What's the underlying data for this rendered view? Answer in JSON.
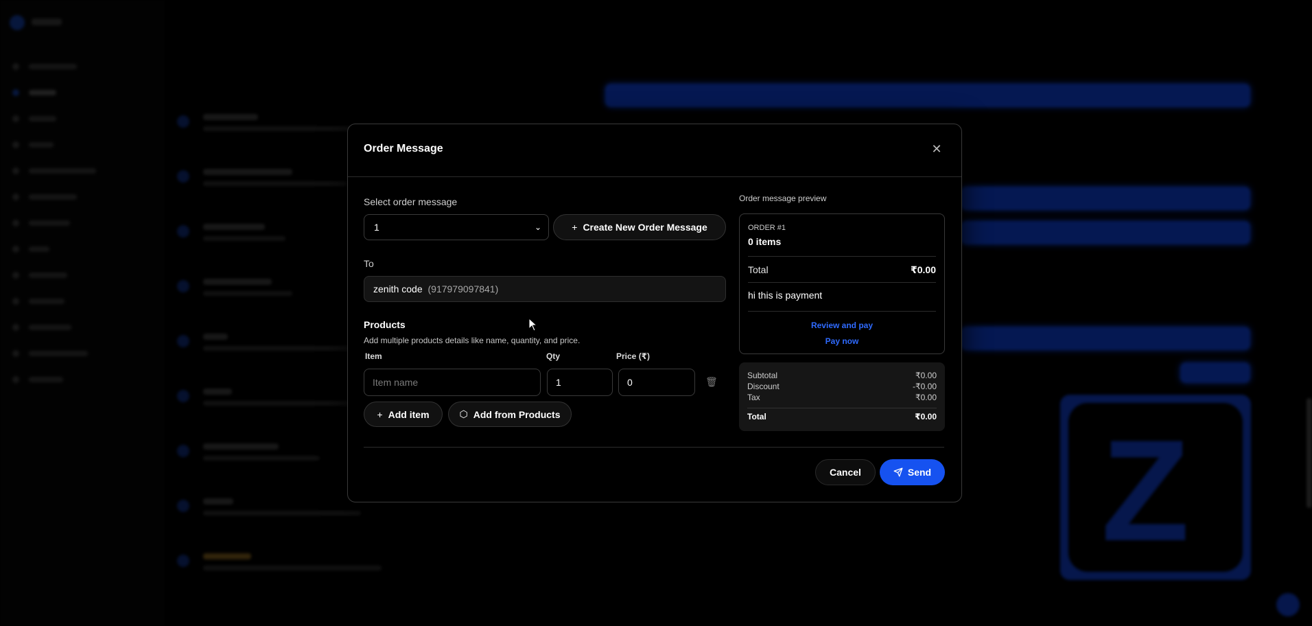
{
  "modal": {
    "title": "Order Message",
    "close_icon": "close-icon"
  },
  "form": {
    "select_label": "Select order message",
    "select_value": "1",
    "create_button_label": "Create New Order Message",
    "to_label": "To",
    "to_name": "zenith code",
    "to_phone": "(917979097841)",
    "products_title": "Products",
    "products_hint": "Add multiple products details like name, quantity, and price.",
    "columns": {
      "item": "Item",
      "qty": "Qty",
      "price": "Price (₹)"
    },
    "row": {
      "item_placeholder": "Item name",
      "qty": "1",
      "price": "0"
    },
    "add_item_label": "Add item",
    "add_from_products_label": "Add from Products"
  },
  "preview": {
    "label": "Order message preview",
    "order_no": "ORDER #1",
    "items": "0 items",
    "total_label": "Total",
    "total_value": "₹0.00",
    "message": "hi this is payment",
    "review_link": "Review and pay",
    "pay_link": "Pay now"
  },
  "summary": {
    "subtotal_label": "Subtotal",
    "subtotal_value": "₹0.00",
    "discount_label": "Discount",
    "discount_value": "-₹0.00",
    "tax_label": "Tax",
    "tax_value": "₹0.00",
    "total_label": "Total",
    "total_value": "₹0.00"
  },
  "footer": {
    "cancel_label": "Cancel",
    "send_label": "Send"
  },
  "colors": {
    "accent": "#1652f0",
    "link": "#2f6bff",
    "background": "#000000"
  }
}
